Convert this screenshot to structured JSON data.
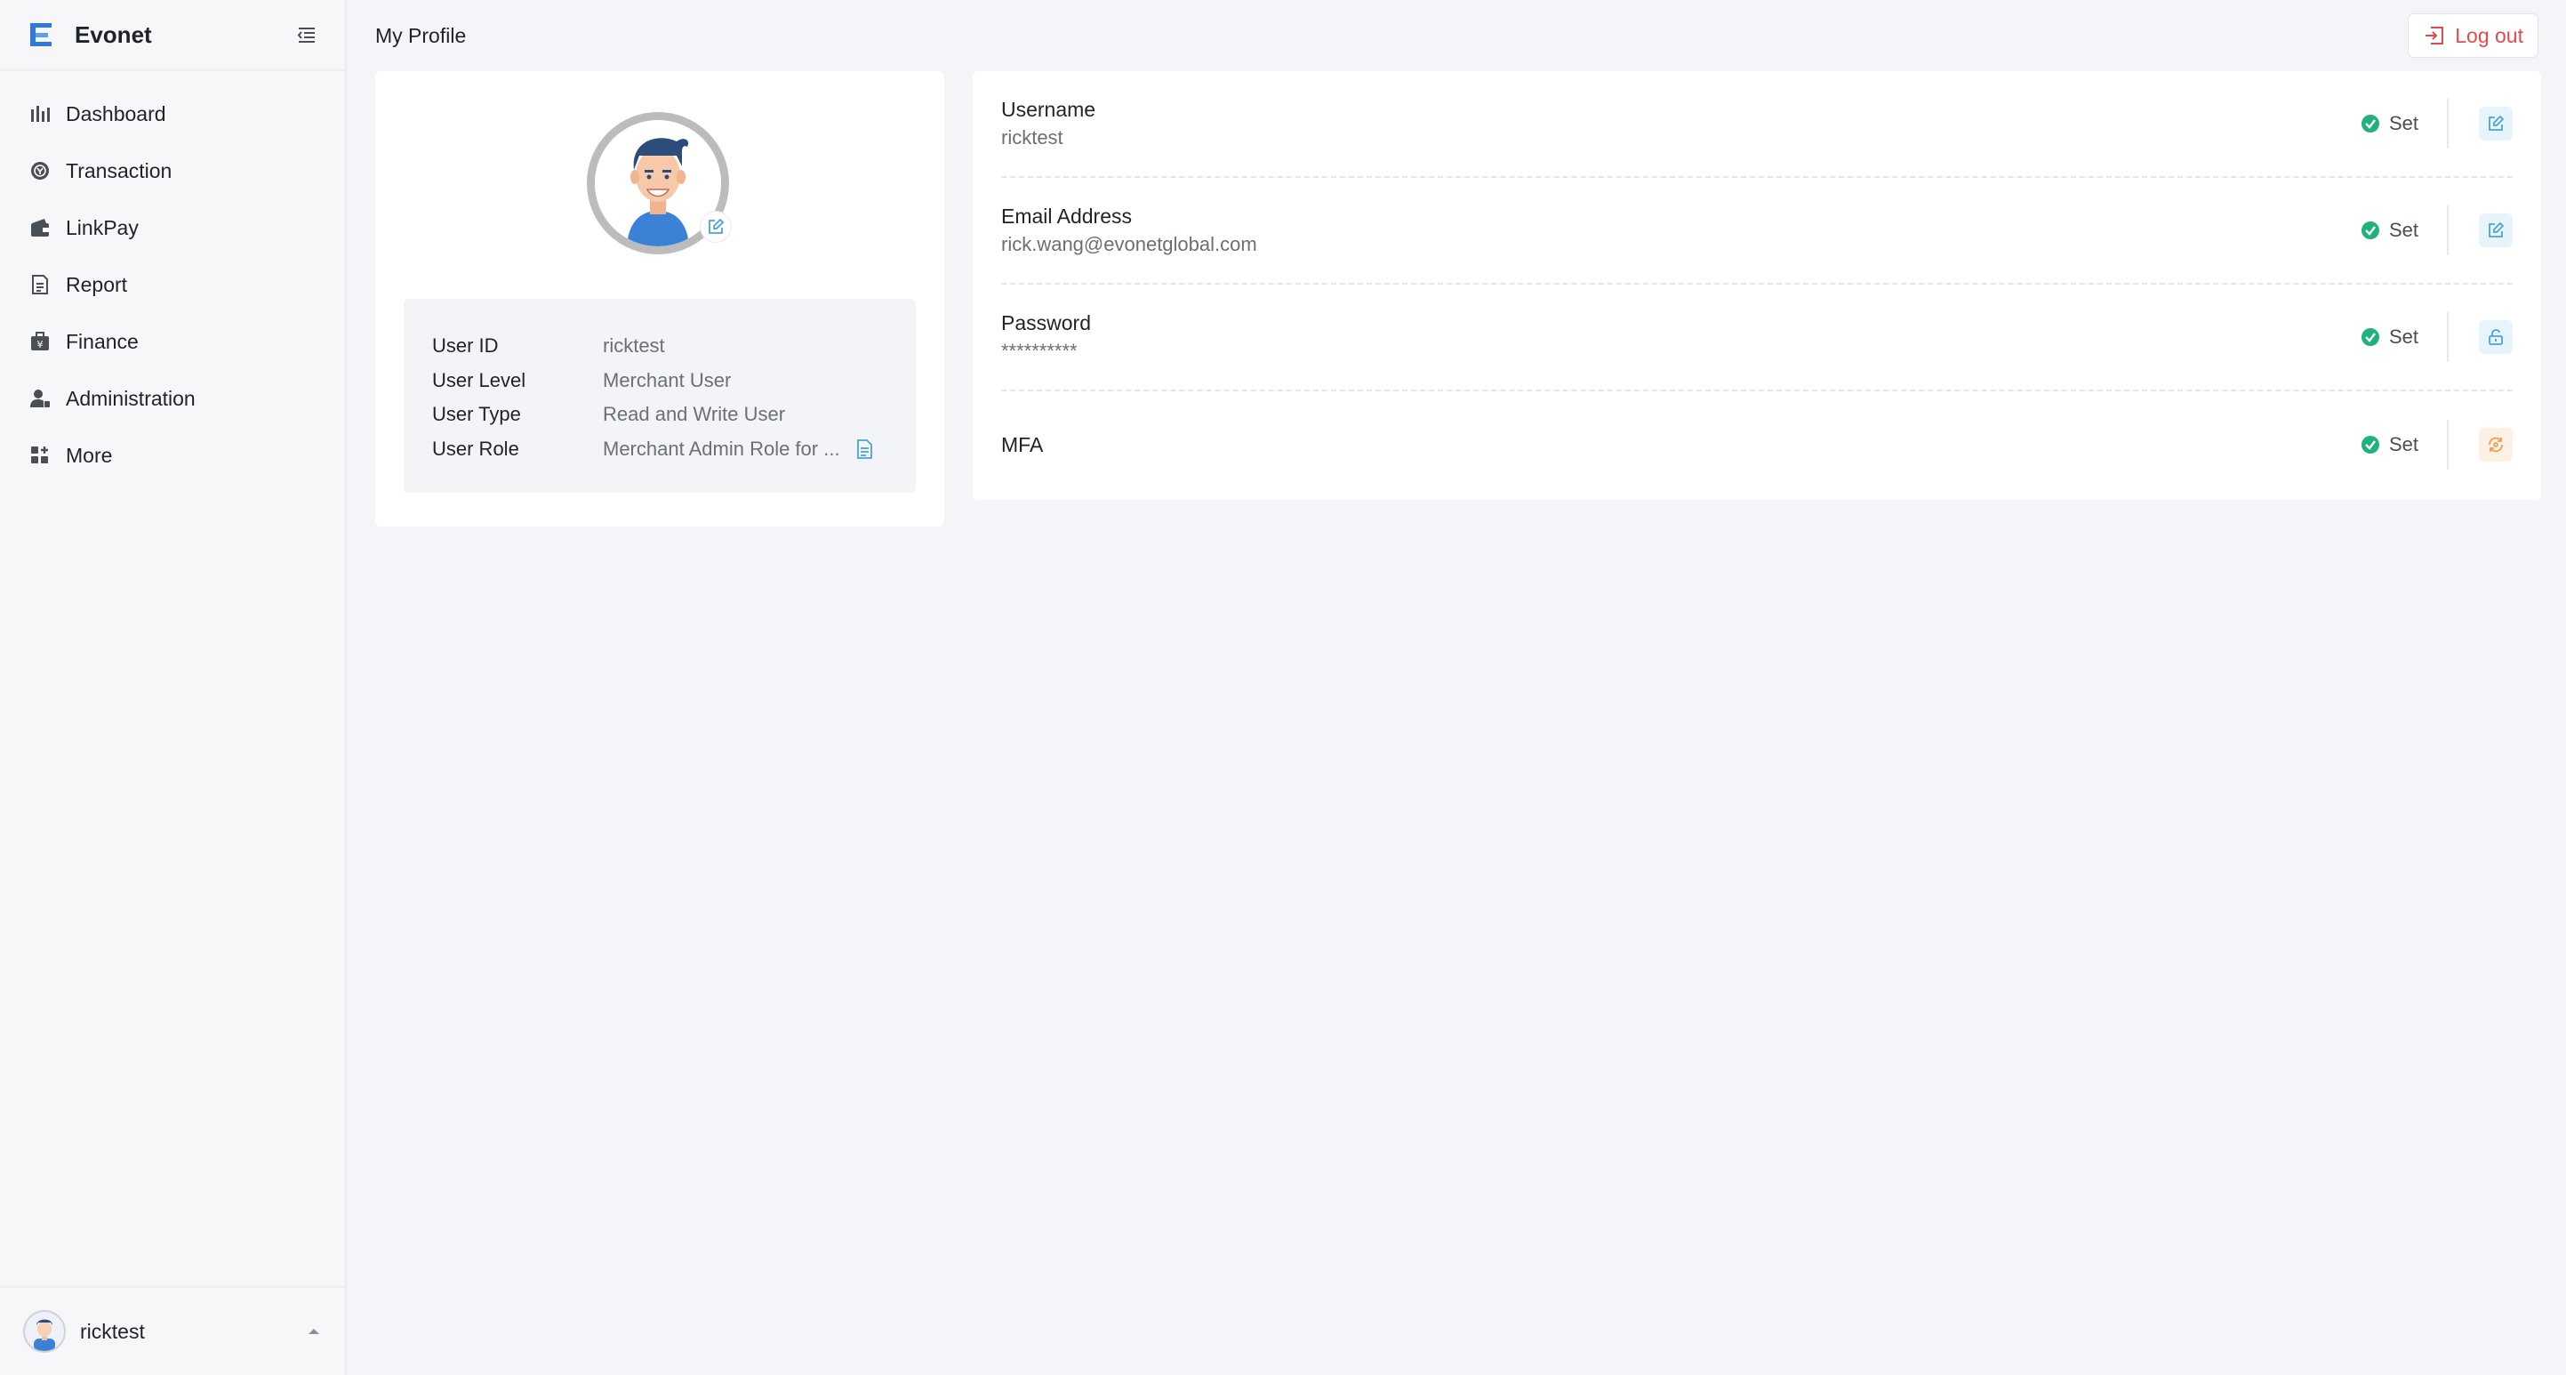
{
  "brand": {
    "name": "Evonet"
  },
  "sidebar": {
    "items": [
      {
        "label": "Dashboard",
        "icon": "bar-chart-icon"
      },
      {
        "label": "Transaction",
        "icon": "transaction-icon"
      },
      {
        "label": "LinkPay",
        "icon": "wallet-icon"
      },
      {
        "label": "Report",
        "icon": "report-icon"
      },
      {
        "label": "Finance",
        "icon": "finance-icon"
      },
      {
        "label": "Administration",
        "icon": "admin-icon"
      },
      {
        "label": "More",
        "icon": "grid-icon"
      }
    ],
    "user": {
      "name": "ricktest"
    }
  },
  "header": {
    "title": "My Profile",
    "logout_label": "Log out"
  },
  "profile": {
    "rows": [
      {
        "label": "User ID",
        "value": "ricktest"
      },
      {
        "label": "User Level",
        "value": "Merchant User"
      },
      {
        "label": "User Type",
        "value": "Read and Write User"
      },
      {
        "label": "User Role",
        "value": "Merchant Admin Role for ..."
      }
    ]
  },
  "settings": [
    {
      "title": "Username",
      "value": "ricktest",
      "status": "Set",
      "action": "edit"
    },
    {
      "title": "Email Address",
      "value": "rick.wang@evonetglobal.com",
      "status": "Set",
      "action": "edit"
    },
    {
      "title": "Password",
      "value": "**********",
      "status": "Set",
      "action": "change-password"
    },
    {
      "title": "MFA",
      "value": "",
      "status": "Set",
      "action": "mfa"
    }
  ],
  "colors": {
    "brand_blue": "#2f7ad9",
    "logout_red": "#e14b4b",
    "status_green": "#1fb27a",
    "action_blue": "#4aa3d8",
    "action_orange": "#f0a050"
  }
}
